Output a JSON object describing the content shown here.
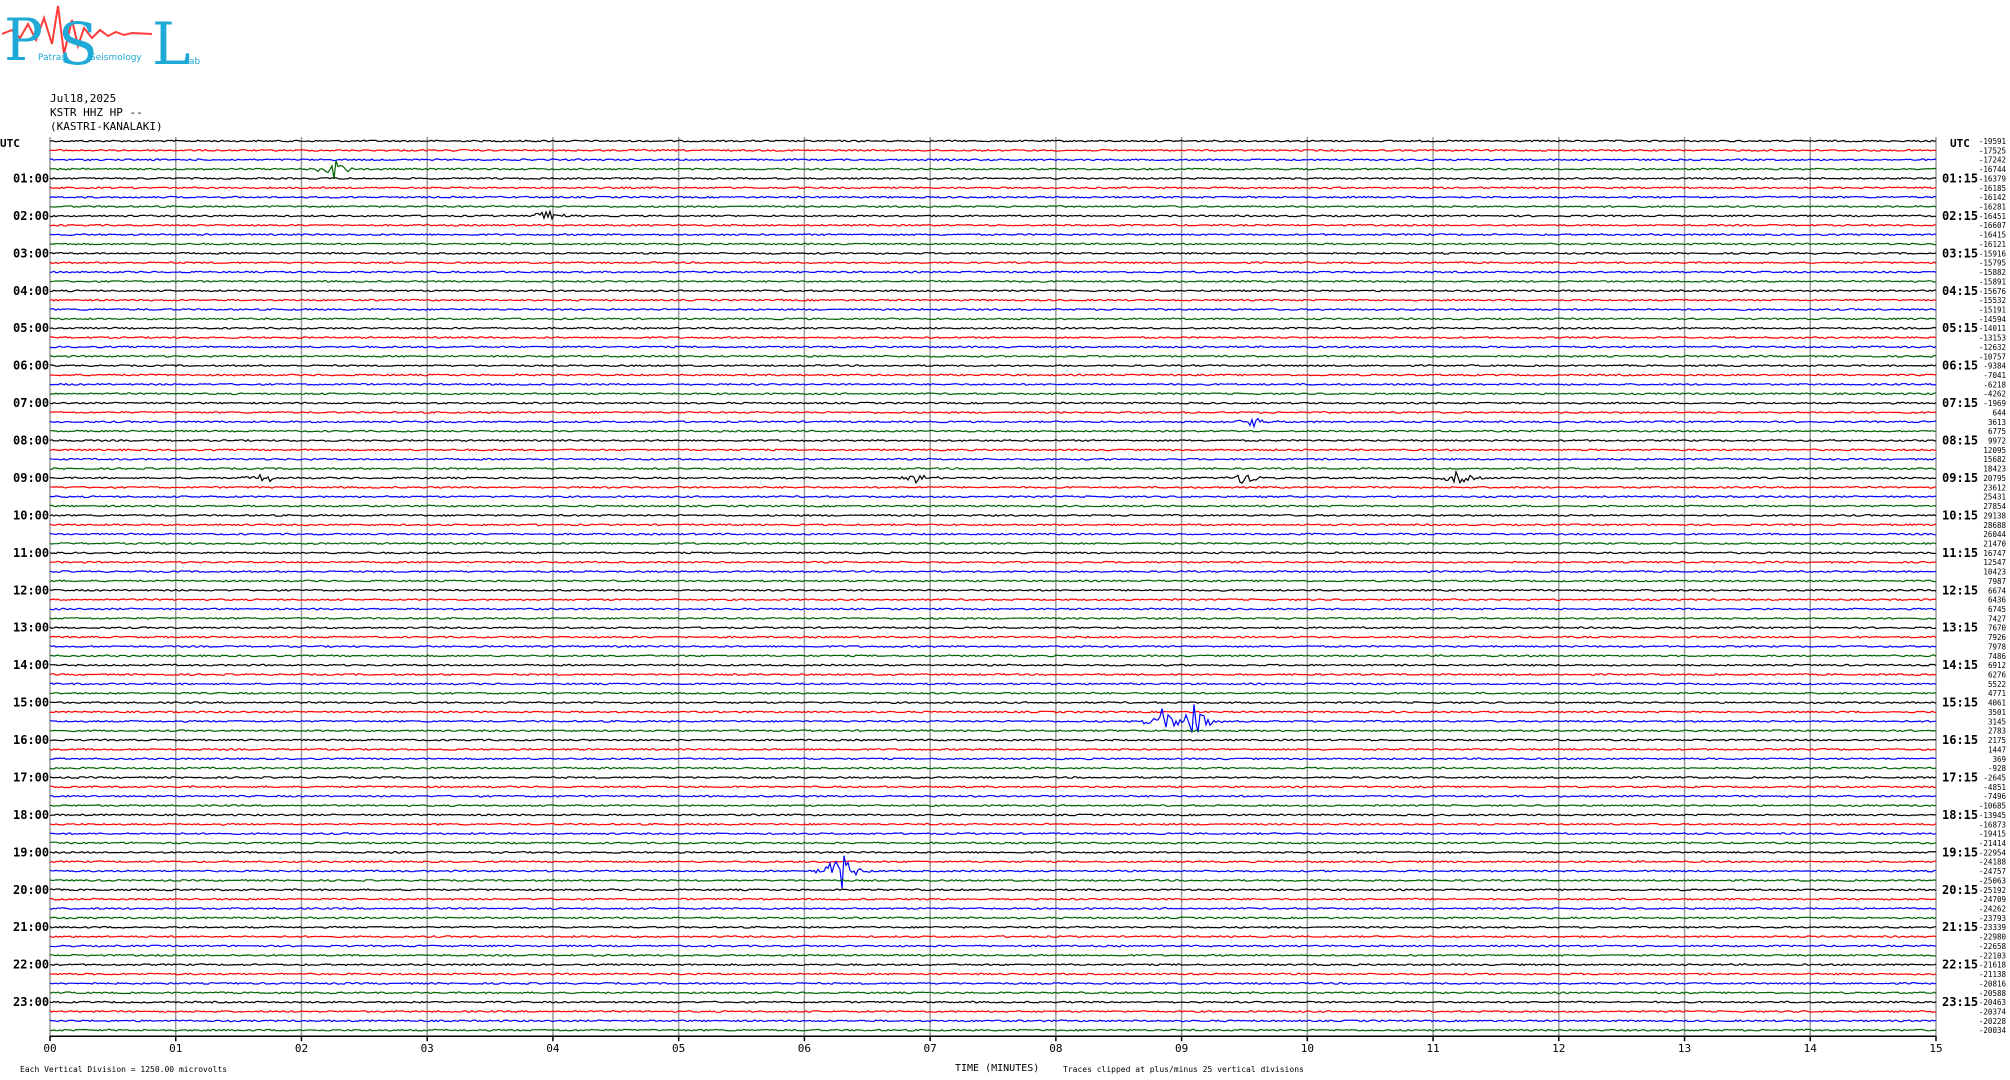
{
  "logo": {
    "letters": [
      "P",
      "S",
      "L"
    ],
    "words": [
      "Patras",
      "Seismology",
      "Lab"
    ],
    "colors": {
      "letters": "#1fa9d6",
      "trace": "#ff3b3b"
    }
  },
  "header": {
    "date": "Jul18,2025",
    "station": "KSTR HHZ HP --",
    "location": "(KASTRI-KANALAKI)"
  },
  "chart_data": {
    "type": "line",
    "title": "",
    "xlabel": "TIME (MINUTES)",
    "ylabel": "",
    "xlim": [
      0,
      15
    ],
    "x_ticks": [
      "00",
      "01",
      "02",
      "03",
      "04",
      "05",
      "06",
      "07",
      "08",
      "09",
      "10",
      "11",
      "12",
      "13",
      "14",
      "15"
    ],
    "axis_label_left": "UTC",
    "axis_label_right": "UTC",
    "left_hour_labels": [
      "01:00",
      "02:00",
      "03:00",
      "04:00",
      "05:00",
      "06:00",
      "07:00",
      "08:00",
      "09:00",
      "10:00",
      "11:00",
      "12:00",
      "13:00",
      "14:00",
      "15:00",
      "16:00",
      "17:00",
      "18:00",
      "19:00",
      "20:00",
      "21:00",
      "22:00",
      "23:00"
    ],
    "right_hour_labels": [
      "01:15",
      "02:15",
      "03:15",
      "04:15",
      "05:15",
      "06:15",
      "07:15",
      "08:15",
      "09:15",
      "10:15",
      "11:15",
      "12:15",
      "13:15",
      "14:15",
      "15:15",
      "16:15",
      "17:15",
      "18:15",
      "19:15",
      "20:15",
      "21:15",
      "22:15",
      "23:15"
    ],
    "trace_colors": [
      "#000000",
      "#ff0000",
      "#0000ff",
      "#006400"
    ],
    "rows_per_hour": 4,
    "row_offsets": [
      -19591,
      -17525,
      -17242,
      -16744,
      -16379,
      -16185,
      -16142,
      -16281,
      -16451,
      -16607,
      -16415,
      -16121,
      -15916,
      -15795,
      -15882,
      -15891,
      -15676,
      -15532,
      -15191,
      -14594,
      -14011,
      -13153,
      -12632,
      -10757,
      -9384,
      -7041,
      -6218,
      -4262,
      -1969,
      644,
      3613,
      6775,
      9972,
      12095,
      15682,
      18423,
      20795,
      23612,
      25431,
      27854,
      29138,
      28688,
      26044,
      21470,
      16747,
      12547,
      10423,
      7987,
      6674,
      6436,
      6745,
      7427,
      7670,
      7926,
      7978,
      7486,
      6912,
      6276,
      5522,
      4771,
      4061,
      3501,
      3145,
      2783,
      2175,
      1447,
      369,
      -928,
      -2645,
      -4851,
      -7496,
      -10685,
      -13945,
      -16873,
      -19415,
      -21414,
      -22954,
      -24188,
      -24757,
      -25063,
      -25192,
      -24709,
      -24262,
      -23793,
      -23339,
      -22980,
      -22658,
      -22103,
      -21618,
      -21138,
      -20816,
      -20588,
      -20463,
      -20374,
      -20228,
      -20034
    ],
    "events": [
      {
        "row": 3,
        "minute": 2.25,
        "amplitude": 3
      },
      {
        "row": 8,
        "minute": 3.95,
        "amplitude": 2
      },
      {
        "row": 30,
        "minute": 9.55,
        "amplitude": 2
      },
      {
        "row": 36,
        "minute": 1.7,
        "amplitude": 1.5
      },
      {
        "row": 36,
        "minute": 6.9,
        "amplitude": 1.5
      },
      {
        "row": 36,
        "minute": 9.5,
        "amplitude": 2
      },
      {
        "row": 36,
        "minute": 11.2,
        "amplitude": 2
      },
      {
        "row": 62,
        "minute": 8.85,
        "amplitude": 4
      },
      {
        "row": 62,
        "minute": 9.1,
        "amplitude": 5
      },
      {
        "row": 78,
        "minute": 6.28,
        "amplitude": 6
      }
    ],
    "footer_left": "Each Vertical Division = 1250.00 microvolts",
    "footer_right": "Traces clipped at plus/minus 25 vertical divisions"
  }
}
